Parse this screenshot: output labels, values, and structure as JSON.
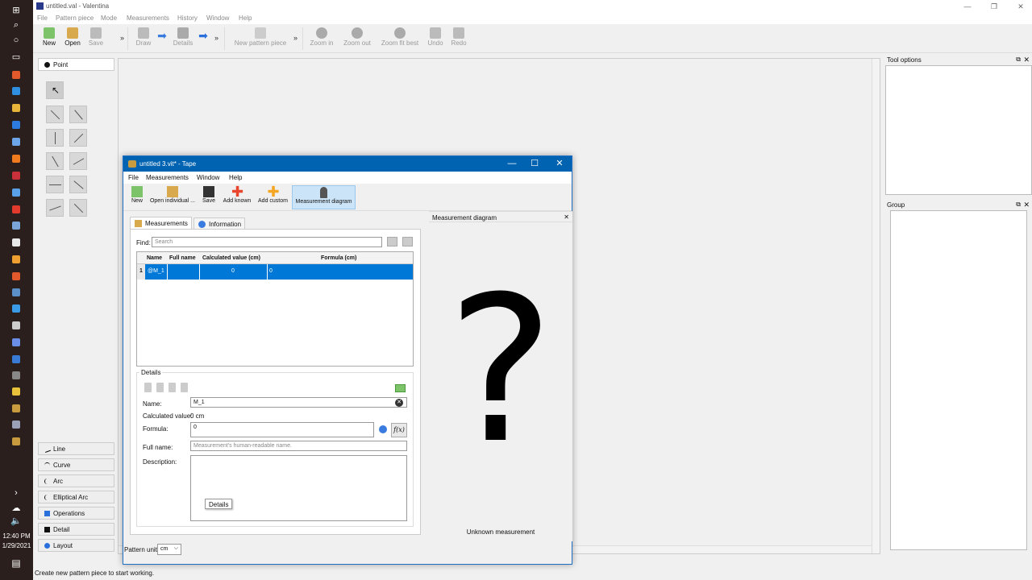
{
  "taskbar": {
    "clock_time": "12:40 PM",
    "clock_date": "1/29/2021"
  },
  "main_window": {
    "title": "untitled.val - Valentina",
    "menu": [
      "File",
      "Pattern piece",
      "Mode",
      "Measurements",
      "History",
      "Window",
      "Help"
    ],
    "toolbar": {
      "new": "New",
      "open": "Open",
      "save": "Save",
      "draw": "Draw",
      "details": "Details",
      "new_pattern_piece": "New pattern piece",
      "zoom_in": "Zoom in",
      "zoom_out": "Zoom out",
      "zoom_fit_best": "Zoom fit best",
      "undo": "Undo",
      "redo": "Redo"
    },
    "tool_groups": {
      "point": "Point",
      "line": "Line",
      "curve": "Curve",
      "arc": "Arc",
      "elliptical_arc": "Elliptical Arc",
      "operations": "Operations",
      "detail": "Detail",
      "layout": "Layout"
    },
    "docks": {
      "tool_options": "Tool options",
      "group": "Group"
    },
    "status": "Create new pattern piece to start working."
  },
  "tape_window": {
    "title": "untitled 3.vit* - Tape",
    "menu": [
      "File",
      "Measurements",
      "Window",
      "Help"
    ],
    "toolbar": {
      "new": "New",
      "open_individual": "Open individual ...",
      "save": "Save",
      "add_known": "Add known",
      "add_custom": "Add custom",
      "measurement_diagram": "Measurement diagram"
    },
    "tabs": {
      "measurements": "Measurements",
      "information": "Information"
    },
    "find_label": "Find:",
    "search_placeholder": "Search",
    "table": {
      "columns": [
        "Name",
        "Full name",
        "Calculated value (cm)",
        "Formula (cm)"
      ],
      "rows": [
        {
          "index": "1",
          "name": "@M_1",
          "full_name": "",
          "value": "0",
          "formula": "0"
        }
      ]
    },
    "details": {
      "group_label": "Details",
      "name_label": "Name:",
      "name_value": "M_1",
      "calc_label": "Calculated value:",
      "calc_value": "0 cm",
      "formula_label": "Formula:",
      "formula_value": "0",
      "fx_label": "f(x)",
      "full_name_label": "Full name:",
      "full_name_placeholder": "Measurement's human-readable name.",
      "description_label": "Description:",
      "tooltip": "Details"
    },
    "diagram": {
      "title": "Measurement diagram",
      "symbol": "?",
      "caption": "Unknown measurement"
    },
    "pattern_unit_label": "Pattern unit:",
    "pattern_unit_value": "cm"
  },
  "colors": {
    "title_blue": "#0063b1",
    "selection_blue": "#0078d7",
    "add_known_red": "#e8452c",
    "add_custom_orange": "#f5a623",
    "taskbar_bg": "#2b1f1d"
  }
}
